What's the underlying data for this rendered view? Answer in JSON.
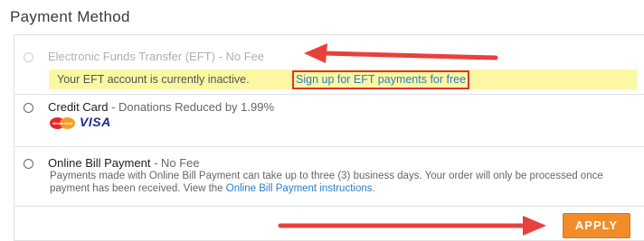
{
  "section": {
    "title": "Payment Method"
  },
  "options": [
    {
      "name": "Electronic Funds Transfer (EFT)",
      "note": " - No Fee",
      "disabled": true,
      "notice_text": "Your EFT account is currently inactive.",
      "notice_link": "Sign up for EFT payments for free"
    },
    {
      "name": "Credit Card",
      "note": " - Donations Reduced by 1.99%",
      "disabled": false,
      "card_logos": [
        "MasterCard",
        "VISA"
      ]
    },
    {
      "name": "Online Bill Payment",
      "note": " - No Fee",
      "disabled": false,
      "desc_text": "Payments made with Online Bill Payment can take up to three (3) business days. Your order will only be processed once payment has been received. View the ",
      "desc_link": "Online Bill Payment instructions",
      "desc_end": "."
    }
  ],
  "apply_label": "APPLY",
  "icons": [
    "radio-icon",
    "mastercard-icon",
    "visa-icon",
    "arrow-icon"
  ],
  "colors": {
    "accent": "#f28c28",
    "link": "#2b7ec9",
    "notice_bg": "#fbf7a3",
    "highlight": "#d9352f"
  }
}
